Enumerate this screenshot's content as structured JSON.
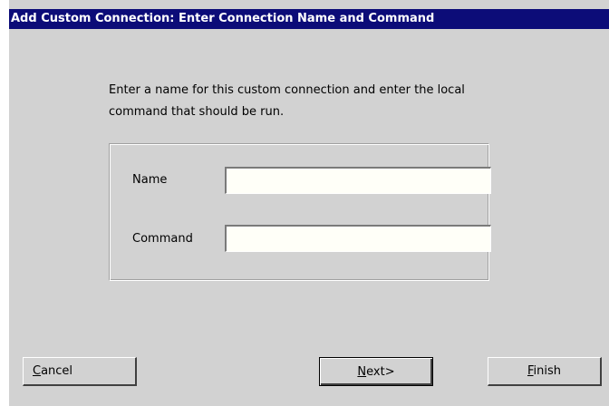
{
  "window": {
    "title": "Add Custom Connection: Enter Connection Name and Command"
  },
  "instructions": {
    "line1": "Enter a name for this custom connection and enter the local",
    "line2": "command that should be run."
  },
  "form": {
    "name_label": "Name",
    "name_value": "",
    "command_label": "Command",
    "command_value": ""
  },
  "buttons": {
    "cancel_mnemonic": "C",
    "cancel_rest": "ancel",
    "next_mnemonic": "N",
    "next_rest": "ext>",
    "finish_mnemonic": "F",
    "finish_rest": "inish"
  },
  "colors": {
    "titlebar": "#0c0c78",
    "background": "#d2d2d2",
    "input_background": "#fffff8"
  }
}
